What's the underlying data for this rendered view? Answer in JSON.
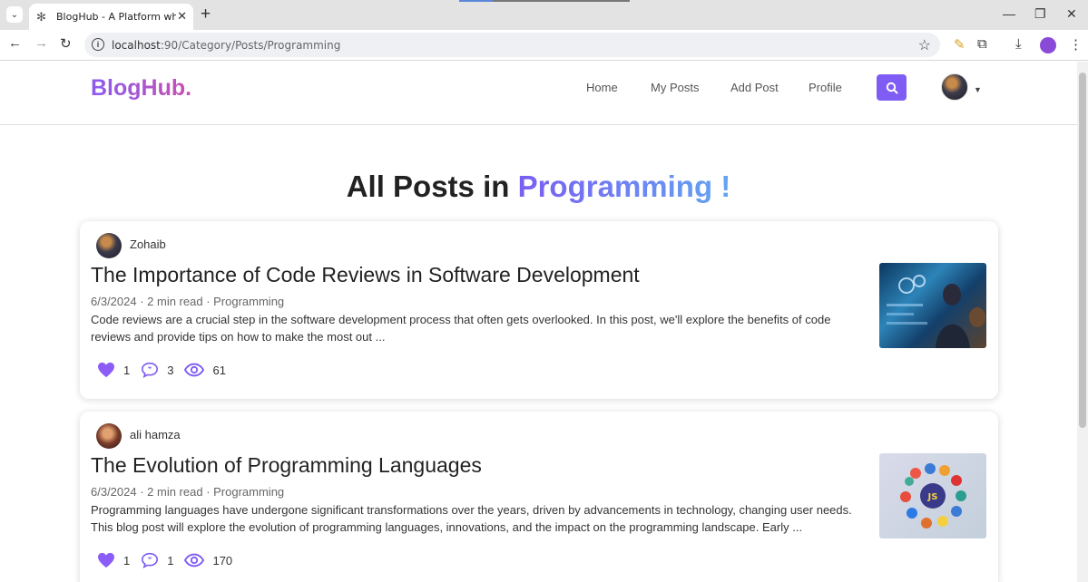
{
  "browser": {
    "tab_title": "BlogHub - A Platform where yo",
    "url_host": "localhost",
    "url_path": ":90/Category/Posts/Programming"
  },
  "site": {
    "logo": "BlogHub.",
    "nav": [
      "Home",
      "My Posts",
      "Add Post",
      "Profile"
    ]
  },
  "heading": {
    "prefix": "All Posts in ",
    "category": "Programming !"
  },
  "posts": [
    {
      "author": "Zohaib",
      "title": "The Importance of Code Reviews in Software Development",
      "meta": "6/3/2024 · 2 min read · Programming",
      "excerpt": "Code reviews are a crucial step in the software development process that often gets overlooked. In this post, we'll explore the benefits of code reviews and provide tips on how to make the most out ...",
      "likes": "1",
      "comments": "3",
      "views": "61",
      "thumbnail": "code-review-image"
    },
    {
      "author": "ali hamza",
      "title": "The Evolution of Programming Languages",
      "meta": "6/3/2024 · 2 min read · Programming",
      "excerpt": "Programming languages have undergone significant transformations over the years, driven by advancements in technology, changing user needs. This blog post will explore the evolution of programming languages, innovations, and the impact on the programming landscape. Early ...",
      "likes": "1",
      "comments": "1",
      "views": "170",
      "thumbnail": "programming-languages-image"
    }
  ],
  "colors": {
    "accent": "#7f5cf3",
    "heart": "#8b5cf6"
  }
}
